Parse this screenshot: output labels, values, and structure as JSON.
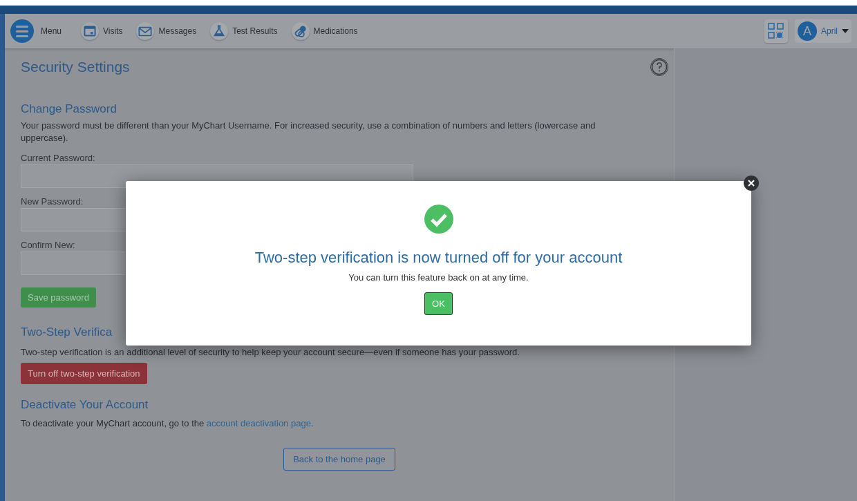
{
  "nav": {
    "menu_label": "Menu",
    "items": [
      {
        "label": "Visits"
      },
      {
        "label": "Messages"
      },
      {
        "label": "Test Results"
      },
      {
        "label": "Medications"
      }
    ],
    "user": {
      "initial": "A",
      "name": "April"
    }
  },
  "page": {
    "title": "Security Settings",
    "change_password": {
      "heading": "Change Password",
      "description": "Your password must be different than your MyChart Username. For increased security, use a combination of numbers and letters (lowercase and uppercase).",
      "fields": [
        {
          "label": "Current Password:"
        },
        {
          "label": "New Password:"
        },
        {
          "label": "Confirm New:"
        }
      ],
      "save_button": "Save password"
    },
    "two_step": {
      "heading": "Two-Step Verifica",
      "description": "Two-step verification is an additional level of security to help keep your account secure—even if someone has your password.",
      "button": "Turn off two-step verification"
    },
    "deactivate": {
      "heading": "Deactivate Your Account",
      "text": "To deactivate your MyChart account, go to the",
      "link": "account deactivation page."
    },
    "back_button": "Back to the home page"
  },
  "dialog": {
    "title": "Two-step verification is now turned off for your account",
    "message": "You can turn this feature back on at any time.",
    "ok_button": "OK"
  }
}
